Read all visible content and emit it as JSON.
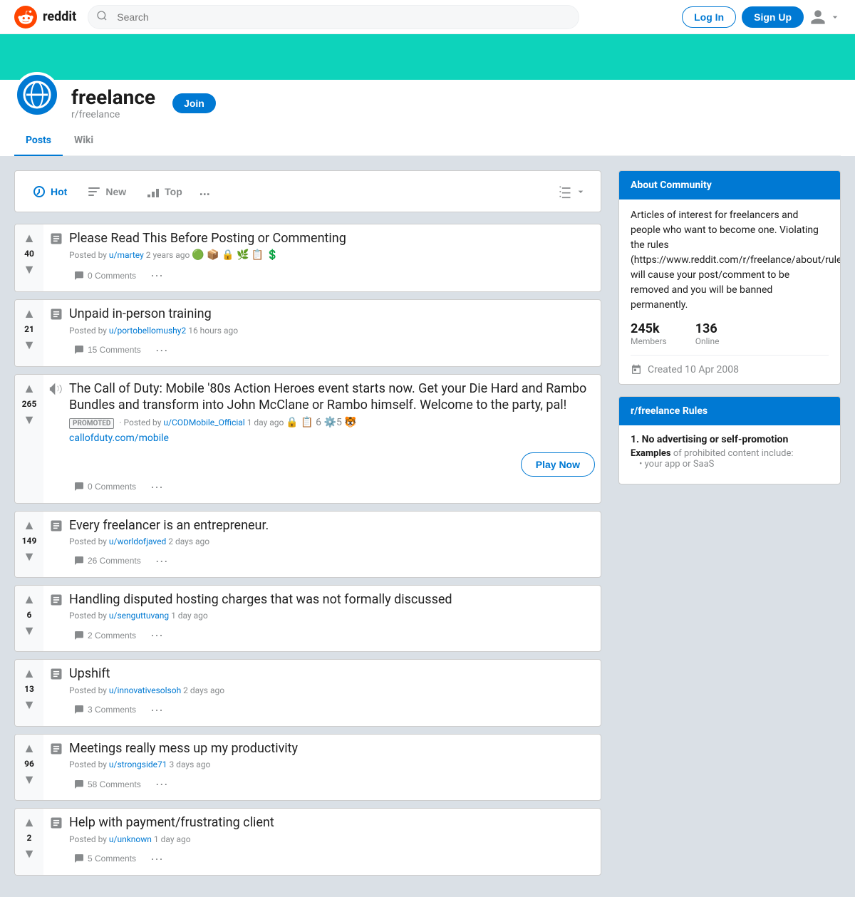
{
  "header": {
    "logo_text": "reddit",
    "search_placeholder": "Search",
    "login_label": "Log In",
    "signup_label": "Sign Up"
  },
  "subreddit": {
    "name": "freelance",
    "handle": "r/freelance",
    "join_label": "Join",
    "banner_color": "#0dd3bb",
    "tabs": [
      {
        "label": "Posts",
        "active": true
      },
      {
        "label": "Wiki",
        "active": false
      }
    ]
  },
  "sort_bar": {
    "options": [
      {
        "label": "Hot",
        "icon": "house",
        "active": true
      },
      {
        "label": "New",
        "icon": "sparkle",
        "active": false
      },
      {
        "label": "Top",
        "icon": "chart",
        "active": false
      }
    ],
    "more_label": "...",
    "view_label": "View"
  },
  "posts": [
    {
      "votes": "40",
      "type": "text",
      "title": "Please Read This Before Posting or Commenting",
      "author": "u/martey",
      "time": "2 years ago",
      "comments": "0",
      "promoted": false,
      "emojis": "🟢 📦 🔒 🌿 📋 💲"
    },
    {
      "votes": "21",
      "type": "text",
      "title": "Unpaid in-person training",
      "author": "u/portobellomushy2",
      "time": "16 hours ago",
      "comments": "15",
      "promoted": false,
      "emojis": ""
    },
    {
      "votes": "265",
      "type": "ad",
      "title": "The Call of Duty: Mobile '80s Action Heroes event starts now. Get your Die Hard and Rambo Bundles and transform into John McClane or Rambo himself. Welcome to the party, pal!",
      "author": "u/CODMobile_Official",
      "time": "1 day ago",
      "comments": "0",
      "promoted": true,
      "ad_link": "callofduty.com/mobile",
      "ad_button": "Play Now",
      "emojis": "🔒 📋 6 ⚙️5 🐯"
    },
    {
      "votes": "149",
      "type": "text",
      "title": "Every freelancer is an entrepreneur.",
      "author": "u/worldofjaved",
      "time": "2 days ago",
      "comments": "26",
      "promoted": false,
      "emojis": ""
    },
    {
      "votes": "6",
      "type": "text",
      "title": "Handling disputed hosting charges that was not formally discussed",
      "author": "u/senguttuvang",
      "time": "1 day ago",
      "comments": "2",
      "promoted": false,
      "emojis": ""
    },
    {
      "votes": "13",
      "type": "text",
      "title": "Upshift",
      "author": "u/innovativesolsoh",
      "time": "2 days ago",
      "comments": "3",
      "promoted": false,
      "emojis": ""
    },
    {
      "votes": "96",
      "type": "text",
      "title": "Meetings really mess up my productivity",
      "author": "u/strongside71",
      "time": "3 days ago",
      "comments": "58",
      "promoted": false,
      "emojis": ""
    },
    {
      "votes": "2",
      "type": "text",
      "title": "Help with payment/frustrating client",
      "author": "u/unknown",
      "time": "1 day ago",
      "comments": "5",
      "promoted": false,
      "emojis": ""
    }
  ],
  "about": {
    "header": "About Community",
    "description": "Articles of interest for freelancers and people who want to become one. Violating the rules (https://www.reddit.com/r/freelance/about/rules) will cause your post/comment to be removed and you will be banned permanently.",
    "members_value": "245k",
    "members_label": "Members",
    "online_value": "136",
    "online_label": "Online",
    "created_label": "Created 10 Apr 2008"
  },
  "rules": {
    "header": "r/freelance Rules",
    "items": [
      {
        "number": "1.",
        "title": "No advertising or self-promotion",
        "examples_label": "Examples",
        "examples_text": " of prohibited content include:",
        "bullet": "• your app or SaaS"
      }
    ]
  }
}
